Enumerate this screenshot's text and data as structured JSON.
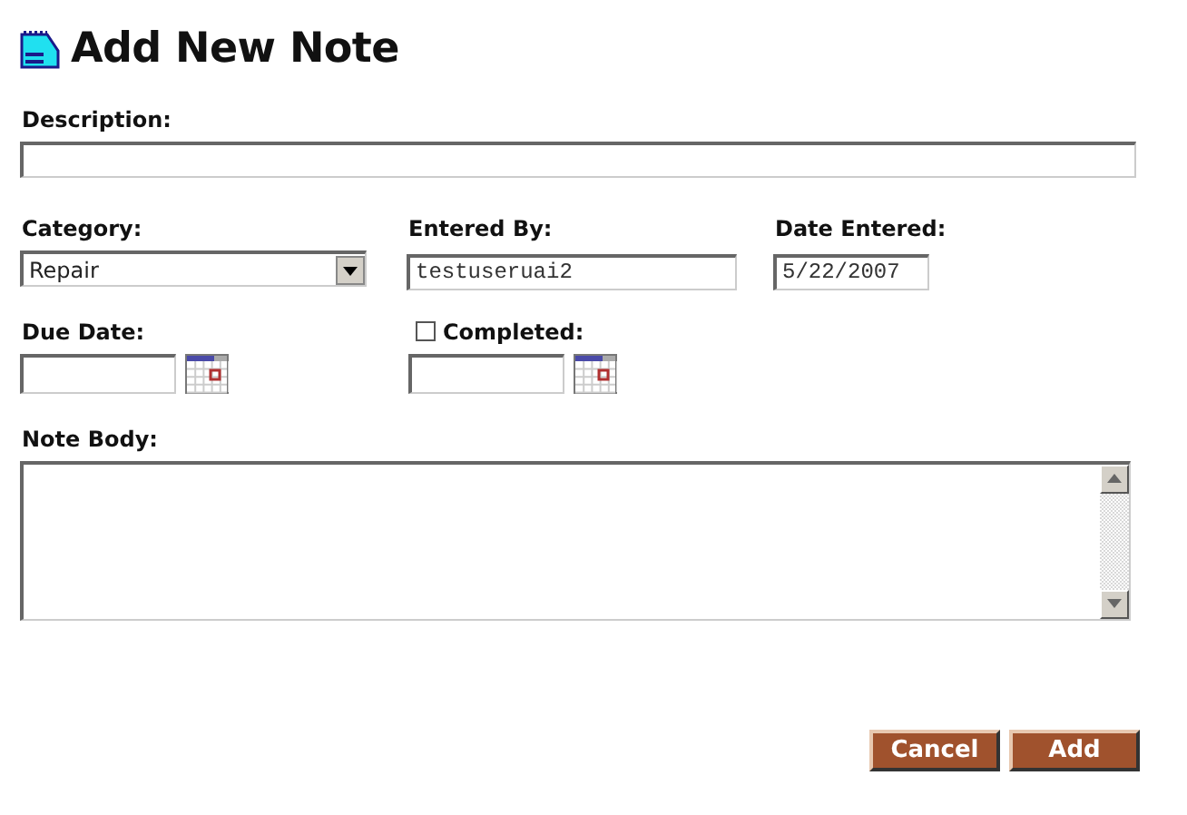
{
  "title": "Add New Note",
  "description": {
    "label": "Description:"
  },
  "category": {
    "label": "Category:",
    "value": "Repair"
  },
  "entered_by": {
    "label": "Entered By:",
    "value": "testuseruai2"
  },
  "date_entered": {
    "label": "Date Entered:",
    "value": "5/22/2007"
  },
  "due_date": {
    "label": "Due Date:"
  },
  "completed": {
    "label": "Completed:",
    "checked": false
  },
  "note_body": {
    "label": "Note Body:"
  },
  "buttons": [
    {
      "label": "Cancel"
    },
    {
      "label": "Add"
    }
  ]
}
